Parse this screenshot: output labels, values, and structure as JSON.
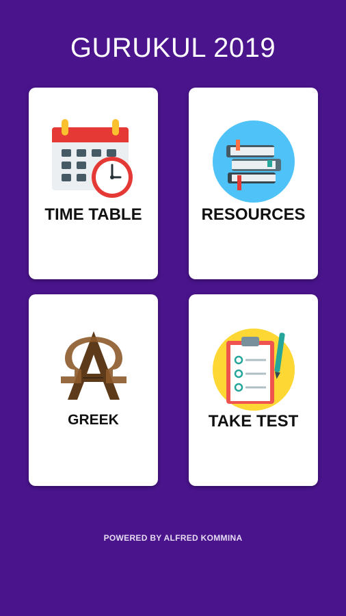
{
  "header": {
    "title": "GURUKUL 2019"
  },
  "cards": [
    {
      "label": "TIME TABLE",
      "icon": "calendar-clock-icon"
    },
    {
      "label": "RESOURCES",
      "icon": "books-icon"
    },
    {
      "label": "GREEK",
      "icon": "alpha-omega-icon"
    },
    {
      "label": "TAKE TEST",
      "icon": "clipboard-checklist-icon"
    }
  ],
  "footer": {
    "text": "POWERED BY ALFRED KOMMINA"
  },
  "colors": {
    "background": "#4a148c",
    "card": "#ffffff",
    "text_dark": "#111111",
    "calendar_red": "#e53935",
    "books_circle": "#4fc3f7",
    "test_circle": "#fdd835"
  }
}
